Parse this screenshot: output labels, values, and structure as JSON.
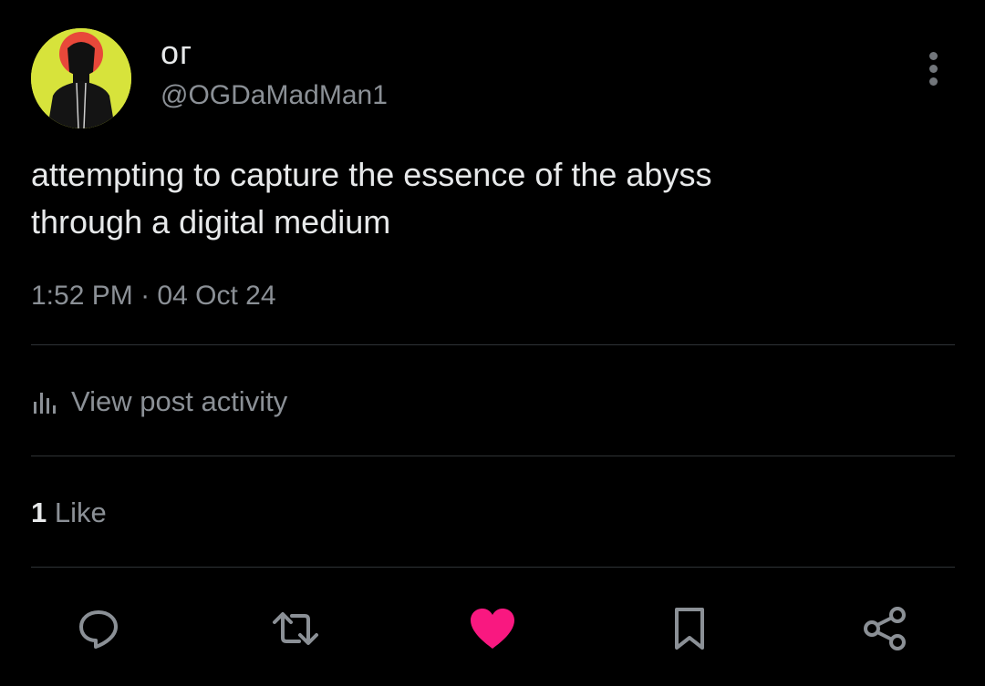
{
  "author": {
    "display_name": "oг",
    "handle": "@OGDaMadMan1",
    "avatar_colors": {
      "background": "#d7e33b",
      "halo": "#e8483a",
      "figure": "#111111"
    }
  },
  "post": {
    "lines": [
      "attempting to capture the essence of the abyss",
      "through a digital medium"
    ],
    "time": "1:52 PM",
    "separator": "·",
    "date": "04 Oct 24"
  },
  "activity": {
    "icon": "analytics-icon",
    "label": "View post activity"
  },
  "likes": {
    "count": "1",
    "label": "Like"
  },
  "actions": {
    "reply_icon": "reply-icon",
    "repost_icon": "repost-icon",
    "like_icon": "heart-icon",
    "like_state": "liked",
    "bookmark_icon": "bookmark-icon",
    "share_icon": "share-icon"
  },
  "colors": {
    "background": "#000000",
    "text_primary": "#e7e9ea",
    "text_secondary": "#8b9096",
    "divider": "#2f3336",
    "like_active": "#f91880",
    "icon_muted": "#8b9096"
  }
}
